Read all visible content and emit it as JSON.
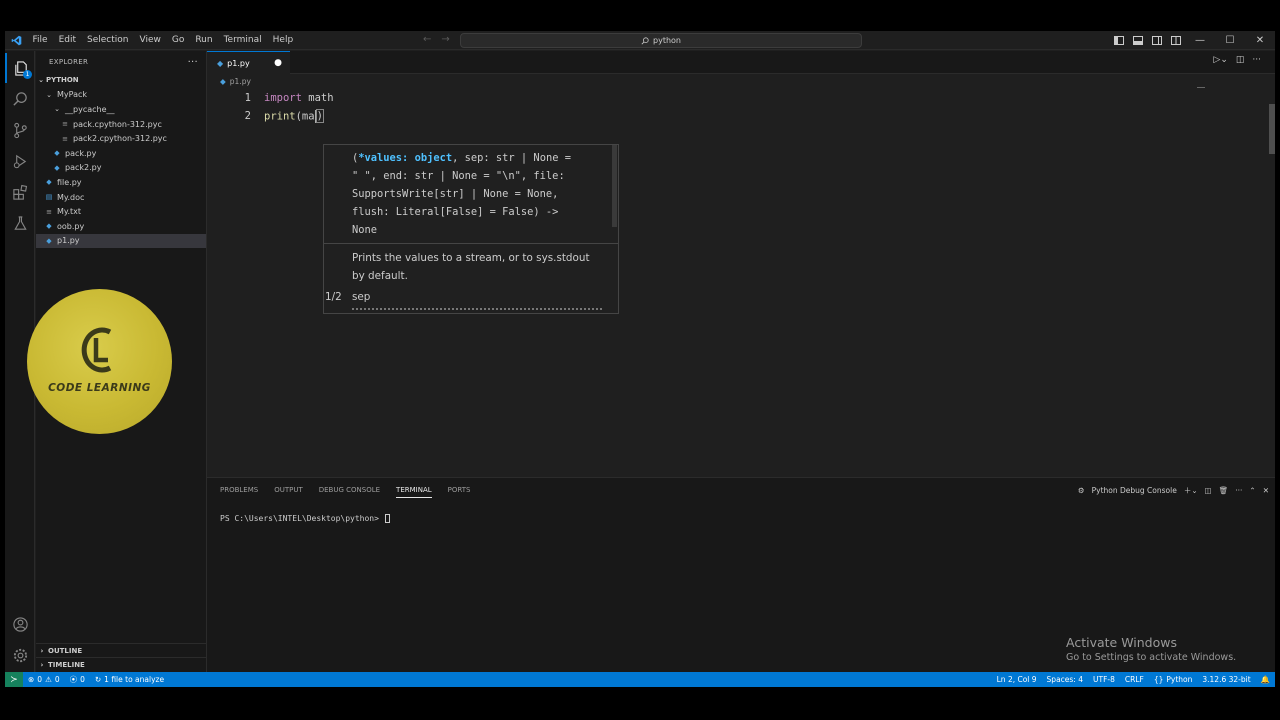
{
  "menu": [
    "File",
    "Edit",
    "Selection",
    "View",
    "Go",
    "Run",
    "Terminal",
    "Help"
  ],
  "command_center": {
    "icon": "search-icon",
    "text": "python"
  },
  "activity_badge": "1",
  "explorer": {
    "title": "EXPLORER",
    "more": "···",
    "root": "PYTHON",
    "items": [
      {
        "label": "MyPack",
        "icon": "chevron-down-icon",
        "indent": 1
      },
      {
        "label": "__pycache__",
        "icon": "chevron-down-icon",
        "indent": 2
      },
      {
        "label": "pack.cpython-312.pyc",
        "icon": "binary-file-icon",
        "indent": 3
      },
      {
        "label": "pack2.cpython-312.pyc",
        "icon": "binary-file-icon",
        "indent": 3
      },
      {
        "label": "pack.py",
        "icon": "python-file-icon",
        "indent": 2
      },
      {
        "label": "pack2.py",
        "icon": "python-file-icon",
        "indent": 2
      },
      {
        "label": "file.py",
        "icon": "python-file-icon",
        "indent": 1
      },
      {
        "label": "My.doc",
        "icon": "doc-file-icon",
        "indent": 1
      },
      {
        "label": "My.txt",
        "icon": "text-file-icon",
        "indent": 1
      },
      {
        "label": "oob.py",
        "icon": "python-file-icon",
        "indent": 1
      },
      {
        "label": "p1.py",
        "icon": "python-file-icon",
        "indent": 1,
        "selected": true
      }
    ],
    "outline": "OUTLINE",
    "timeline": "TIMELINE"
  },
  "watermark": {
    "text": "CODE LEARNING"
  },
  "editor": {
    "tab_label": "p1.py",
    "tab_dirty": "●",
    "breadcrumb": "p1.py",
    "lines": [
      {
        "number": "1",
        "tokens": [
          {
            "t": "import",
            "c": "kw"
          },
          {
            "t": " math",
            "c": "plain"
          }
        ]
      },
      {
        "number": "2",
        "tokens": [
          {
            "t": "print",
            "c": "fn"
          },
          {
            "t": "(ma",
            "c": "plain"
          },
          {
            "t": ")",
            "c": "paren"
          }
        ]
      }
    ]
  },
  "signature_help": {
    "signature_lines": [
      "(*values: object, sep: str | None =",
      "\" \", end: str | None = \"\\n\", file:",
      "SupportsWrite[str] | None = None,",
      "flush: Literal[False] = False) ->",
      "None"
    ],
    "active_param": "*values: object",
    "doc": "Prints the values to a stream, or to sys.stdout by default.",
    "counter": "1/2",
    "param_name": "sep"
  },
  "panel": {
    "tabs": [
      "PROBLEMS",
      "OUTPUT",
      "DEBUG CONSOLE",
      "TERMINAL",
      "PORTS"
    ],
    "active_tab": "TERMINAL",
    "terminal_name": "Python Debug Console",
    "prompt": "PS C:\\Users\\INTEL\\Desktop\\python> "
  },
  "activation": {
    "title": "Activate Windows",
    "subtitle": "Go to Settings to activate Windows."
  },
  "status": {
    "errors": "0",
    "warnings": "0",
    "ports": "0",
    "analyze": "1 file to analyze",
    "position": "Ln 2, Col 9",
    "spaces": "Spaces: 4",
    "encoding": "UTF-8",
    "eol": "CRLF",
    "language": "Python",
    "interpreter": "3.12.6 32-bit"
  },
  "colors": {
    "accent": "#0078d4",
    "keyword": "#c586c0",
    "function": "#dcdcaa",
    "param_highlight": "#4fc1ff",
    "logo_gold": "#c9b933"
  }
}
